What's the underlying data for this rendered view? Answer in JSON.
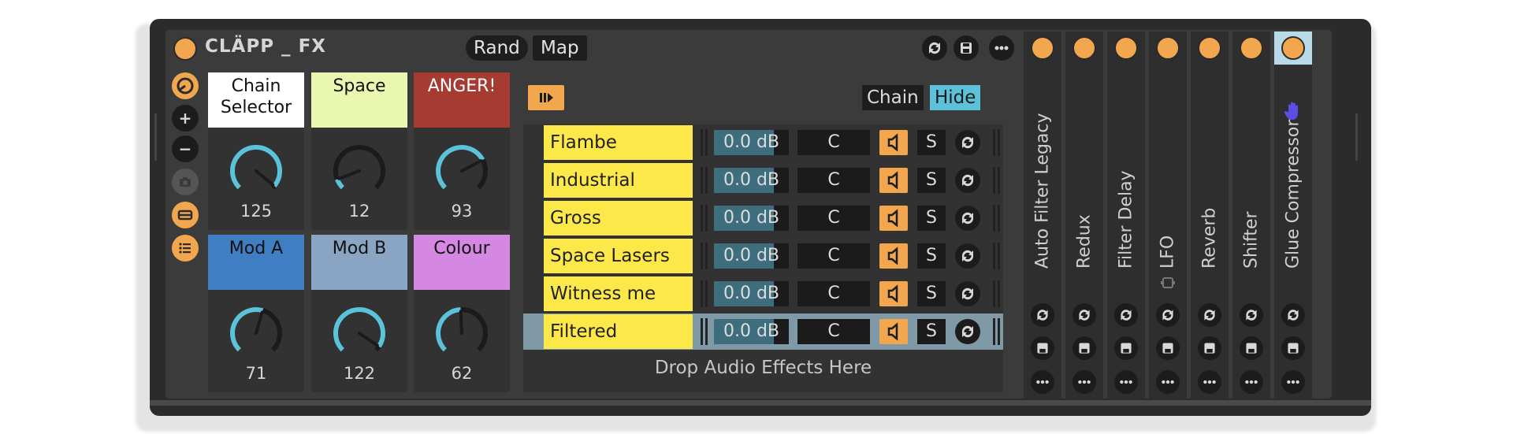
{
  "rack": {
    "title": "CLÄPP _ FX",
    "rand_label": "Rand",
    "map_label": "Map",
    "accent_color": "#f2a64e"
  },
  "macros": [
    {
      "label": "Chain Selector",
      "value": "125",
      "color": "#ffffff",
      "text_color": "#111111",
      "level": 0.98
    },
    {
      "label": "Space",
      "value": "12",
      "color": "#eaf7b0",
      "text_color": "#111111",
      "level": 0.09
    },
    {
      "label": "ANGER!",
      "value": "93",
      "color": "#a63b31",
      "text_color": "#ffffff",
      "level": 0.73
    },
    {
      "label": "Mod A",
      "value": "71",
      "color": "#3f7ec2",
      "text_color": "#111111",
      "level": 0.56
    },
    {
      "label": "Mod B",
      "value": "122",
      "color": "#8aa5c4",
      "text_color": "#111111",
      "level": 0.96
    },
    {
      "label": "Colour",
      "value": "62",
      "color": "#d488e2",
      "text_color": "#111111",
      "level": 0.49
    }
  ],
  "chain_list": {
    "chain_label": "Chain",
    "hide_label": "Hide",
    "drop_hint": "Drop Audio Effects Here",
    "chains": [
      {
        "name": "Flambe",
        "volume": "0.0 dB",
        "pan": "C",
        "solo": "S"
      },
      {
        "name": "Industrial",
        "volume": "0.0 dB",
        "pan": "C",
        "solo": "S"
      },
      {
        "name": "Gross",
        "volume": "0.0 dB",
        "pan": "C",
        "solo": "S"
      },
      {
        "name": "Space Lasers",
        "volume": "0.0 dB",
        "pan": "C",
        "solo": "S"
      },
      {
        "name": "Witness me",
        "volume": "0.0 dB",
        "pan": "C",
        "solo": "S"
      },
      {
        "name": "Filtered",
        "volume": "0.0 dB",
        "pan": "C",
        "solo": "S",
        "selected": true
      }
    ]
  },
  "devices": [
    {
      "name": "Auto Filter Legacy"
    },
    {
      "name": "Redux"
    },
    {
      "name": "Filter Delay"
    },
    {
      "name": "LFO"
    },
    {
      "name": "Reverb"
    },
    {
      "name": "Shifter"
    },
    {
      "name": "Glue Compressor",
      "selected": true
    }
  ]
}
